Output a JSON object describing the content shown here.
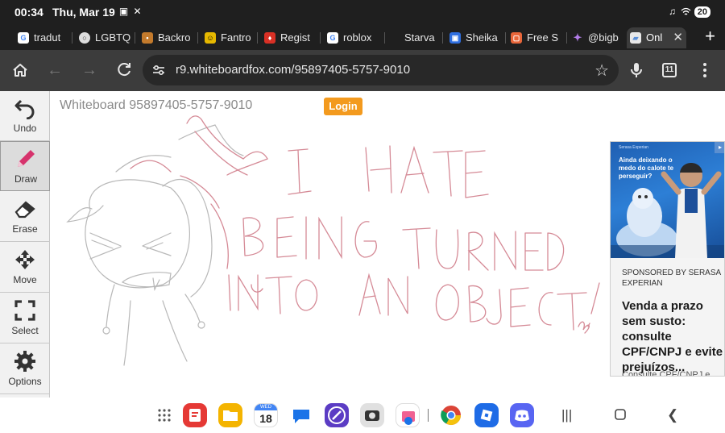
{
  "status": {
    "time": "00:34",
    "date": "Thu, Mar 19",
    "battery": "20"
  },
  "tabs": [
    {
      "label": "tradut",
      "fav": "G",
      "fav_color": "#4285f4"
    },
    {
      "label": "LGBTQ",
      "fav": "○",
      "fav_color": "#666666"
    },
    {
      "label": "Backro",
      "fav": "•",
      "fav_color": "#c37a2c"
    },
    {
      "label": "Fantro",
      "fav": "☺",
      "fav_color": "#e6b800"
    },
    {
      "label": "Regist",
      "fav": "♦",
      "fav_color": "#d93025"
    },
    {
      "label": "roblox",
      "fav": "G",
      "fav_color": "#4285f4"
    },
    {
      "label": "Starva",
      "fav": "",
      "fav_color": "#1f1f1f"
    },
    {
      "label": "Sheika",
      "fav": "▣",
      "fav_color": "#2f6fe0"
    },
    {
      "label": "Free S",
      "fav": "▢",
      "fav_color": "#e8663a"
    },
    {
      "label": "@bigb",
      "fav": "✦",
      "fav_color": "#9b59d0"
    },
    {
      "label": "Onl",
      "fav": "▰",
      "fav_color": "#5a8fd8"
    }
  ],
  "toolbar": {
    "url": "r9.whiteboardfox.com/95897405-5757-9010",
    "tab_count": "11"
  },
  "whiteboard": {
    "title": "Whiteboard 95897405-5757-9010",
    "login_label": "Login",
    "tools": [
      {
        "label": "Undo",
        "icon": "undo-icon"
      },
      {
        "label": "Draw",
        "icon": "pencil-icon"
      },
      {
        "label": "Erase",
        "icon": "eraser-icon"
      },
      {
        "label": "Move",
        "icon": "move-icon"
      },
      {
        "label": "Select",
        "icon": "select-icon"
      },
      {
        "label": "Options",
        "icon": "gear-icon"
      }
    ],
    "selected_tool": "Draw",
    "drawing_text": [
      "I HATE",
      "BEING TURNED",
      "INTO AN OBJECT!"
    ],
    "colors": {
      "sketch": "#b8b8b8",
      "ink": "#d58a96"
    }
  },
  "ad": {
    "image_headline": "Ainda deixando o medo do calote te perseguir?",
    "image_brand": "Serasa Experian",
    "sponsor": "SPONSORED BY SERASA EXPERIAN",
    "headline": "Venda a prazo sem susto: consulte CPF/CNPJ e evite prejuízos...",
    "more": "Consulte CPF/CNPJ e..."
  },
  "dock": {
    "apps": [
      "apps-grid-icon",
      "docs-icon",
      "files-icon",
      "calendar-icon",
      "messages-icon",
      "pen-app-icon",
      "camera-icon",
      "store-icon",
      "chrome-icon",
      "roblox-icon",
      "discord-icon"
    ],
    "calendar_day": "18",
    "calendar_month": "WED"
  }
}
